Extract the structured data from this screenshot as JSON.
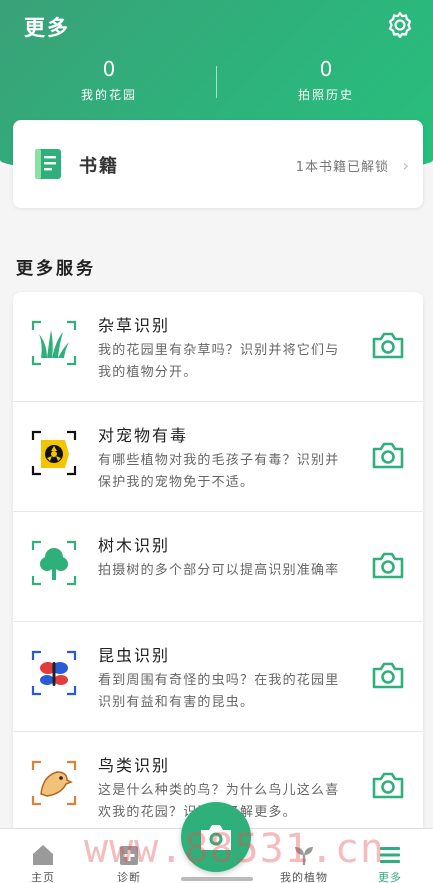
{
  "header": {
    "title": "更多"
  },
  "stats": [
    {
      "value": "0",
      "label": "我的花园"
    },
    {
      "value": "0",
      "label": "拍照历史"
    }
  ],
  "books": {
    "title": "书籍",
    "status": "1本书籍已解锁"
  },
  "section_title": "更多服务",
  "services": [
    {
      "name": "杂草识别",
      "desc": "我的花园里有杂草吗？识别并将它们与我的植物分开。",
      "icon": "grass-icon"
    },
    {
      "name": "对宠物有毒",
      "desc": "有哪些植物对我的毛孩子有毒？识别并保护我的宠物免于不适。",
      "icon": "toxic-icon"
    },
    {
      "name": "树木识别",
      "desc": "拍摄树的多个部分可以提高识别准确率",
      "icon": "tree-icon"
    },
    {
      "name": "昆虫识别",
      "desc": "看到周围有奇怪的虫吗？在我的花园里识别有益和有害的昆虫。",
      "icon": "insect-icon"
    },
    {
      "name": "鸟类识别",
      "desc": "这是什么种类的鸟？为什么鸟儿这么喜欢我的花园？识别并了解更多。",
      "icon": "bird-icon"
    }
  ],
  "tabs": [
    {
      "label": "主页"
    },
    {
      "label": "诊断"
    },
    {
      "label": "我的植物"
    },
    {
      "label": "更多"
    }
  ],
  "watermark": "www.88531.cn",
  "colors": {
    "accent": "#2fb07b",
    "header_start": "#3aa178",
    "header_end": "#27c07d"
  }
}
